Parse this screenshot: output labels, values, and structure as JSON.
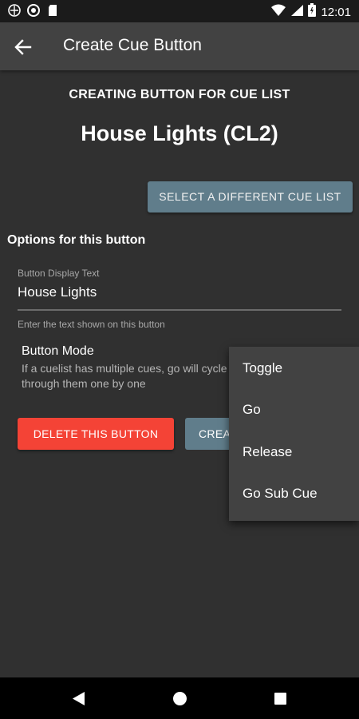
{
  "status_bar": {
    "time": "12:01",
    "icons_left": [
      "sync-icon",
      "circle-icon",
      "sd-card-icon"
    ],
    "icons_right": [
      "wifi-icon",
      "signal-icon",
      "battery-icon"
    ]
  },
  "app_bar": {
    "title": "Create Cue Button",
    "back_icon": "arrow-back-icon"
  },
  "main": {
    "subheading": "CREATING BUTTON FOR CUE LIST",
    "cue_list_name": "House Lights (CL2)",
    "select_button_label": "SELECT A DIFFERENT CUE LIST",
    "options_heading": "Options for this button",
    "display_text_field": {
      "label": "Button Display Text",
      "value": "House Lights",
      "helper": "Enter the text shown on this button"
    },
    "button_mode": {
      "title": "Button Mode",
      "description": "If a cuelist has multiple cues, go will cycle through them one by one"
    },
    "delete_button_label": "DELETE THIS BUTTON",
    "create_button_label": "CREA"
  },
  "mode_menu": {
    "items": [
      "Toggle",
      "Go",
      "Release",
      "Go Sub Cue"
    ]
  },
  "nav_bar": {
    "icons": [
      "back-triangle-icon",
      "home-circle-icon",
      "recents-square-icon"
    ]
  },
  "colors": {
    "background": "#303030",
    "app_bar": "#424242",
    "accent_button": "#607d8b",
    "delete_button": "#f44336"
  }
}
